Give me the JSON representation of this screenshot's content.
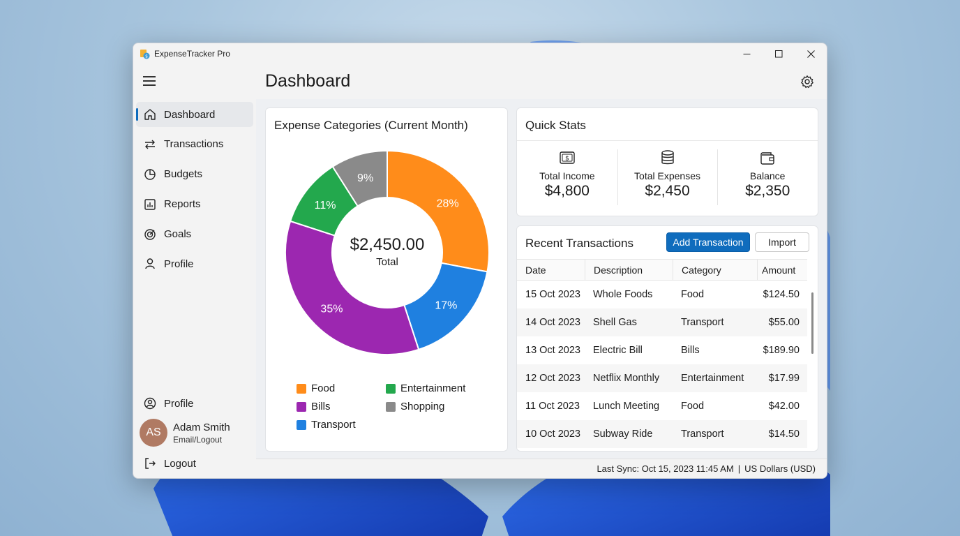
{
  "window": {
    "title": "ExpenseTracker Pro"
  },
  "sidebar": {
    "items": [
      {
        "label": "Dashboard",
        "icon": "home-icon",
        "active": true
      },
      {
        "label": "Transactions",
        "icon": "arrows-swap-icon"
      },
      {
        "label": "Budgets",
        "icon": "pie-icon"
      },
      {
        "label": "Reports",
        "icon": "bar-chart-icon"
      },
      {
        "label": "Goals",
        "icon": "target-icon"
      },
      {
        "label": "Profile",
        "icon": "person-icon"
      }
    ],
    "bottom_profile": "Profile",
    "user": {
      "initials": "AS",
      "name": "Adam Smith",
      "sub": "Email/Logout"
    },
    "logout": "Logout"
  },
  "header": {
    "title": "Dashboard"
  },
  "categories": {
    "title": "Expense Categories (Current Month)",
    "center_value": "$2,450.00",
    "center_label": "Total",
    "slices": [
      {
        "name": "Food",
        "value": 28,
        "label": "28%",
        "color": "#ff8c1a"
      },
      {
        "name": "Transport",
        "value": 17,
        "label": "17%",
        "color": "#1f80e0"
      },
      {
        "name": "Bills",
        "value": 35,
        "label": "35%",
        "color": "#9c27b0"
      },
      {
        "name": "Entertainment",
        "value": 11,
        "label": "11%",
        "color": "#23a84d"
      },
      {
        "name": "Shopping",
        "value": 9,
        "label": "9%",
        "color": "#8a8a8a"
      }
    ],
    "legend": {
      "food": "Food",
      "entertainment": "Entertainment",
      "bills": "Bills",
      "shopping": "Shopping",
      "transport": "Transport"
    }
  },
  "stats": {
    "title": "Quick Stats",
    "income": {
      "label": "Total Income",
      "value": "$4,800",
      "icon": "money-icon"
    },
    "expenses": {
      "label": "Total Expenses",
      "value": "$2,450",
      "icon": "coins-icon"
    },
    "balance": {
      "label": "Balance",
      "value": "$2,350",
      "icon": "wallet-icon"
    }
  },
  "transactions": {
    "title": "Recent Transactions",
    "add_label": "Add Transaction",
    "import_label": "Import",
    "columns": [
      "Date",
      "Description",
      "Category",
      "Amount"
    ],
    "rows": [
      [
        "15 Oct 2023",
        "Whole Foods",
        "Food",
        "$124.50"
      ],
      [
        "14 Oct 2023",
        "Shell Gas",
        "Transport",
        "$55.00"
      ],
      [
        "13 Oct 2023",
        "Electric Bill",
        "Bills",
        "$189.90"
      ],
      [
        "12 Oct 2023",
        "Netflix Monthly",
        "Entertainment",
        "$17.99"
      ],
      [
        "11 Oct 2023",
        "Lunch Meeting",
        "Food",
        "$42.00"
      ],
      [
        "10 Oct 2023",
        "Subway Ride",
        "Transport",
        "$14.50"
      ]
    ]
  },
  "status": {
    "sync": "Last Sync: Oct 15, 2023 11:45 AM",
    "currency": "US Dollars (USD)"
  }
}
